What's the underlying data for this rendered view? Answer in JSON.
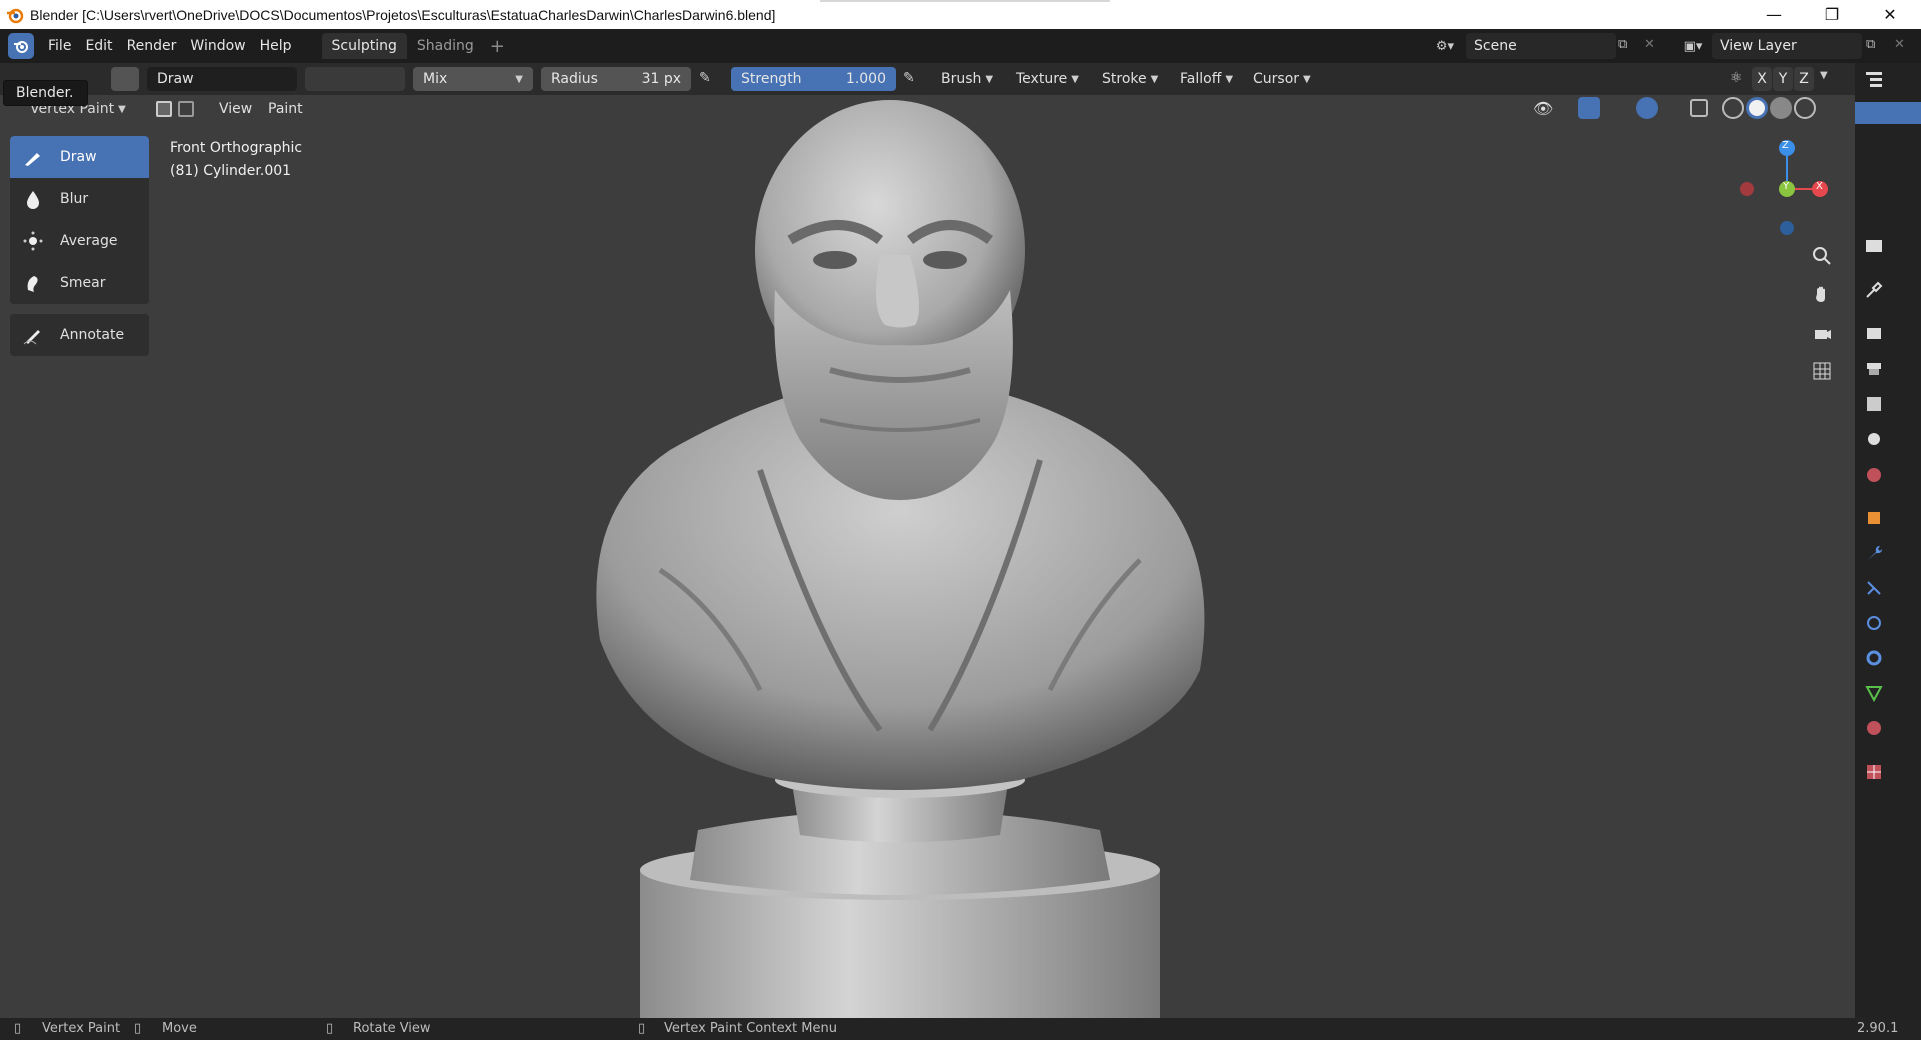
{
  "window": {
    "title": "Blender [C:\\Users\\rvert\\OneDrive\\DOCS\\Documentos\\Projetos\\Esculturas\\EstatuaCharlesDarwin\\CharlesDarwin6.blend]",
    "controls": [
      "—",
      "❐",
      "✕"
    ]
  },
  "menu": [
    "File",
    "Edit",
    "Render",
    "Window",
    "Help"
  ],
  "workspaces": [
    {
      "label": "Sculpting",
      "active": true
    },
    {
      "label": "Shading",
      "active": false
    }
  ],
  "scene": {
    "label": "Scene"
  },
  "view_layer": {
    "label": "View Layer"
  },
  "tool_header": {
    "brush_name": "Draw",
    "blend_mode": "Mix",
    "radius_label": "Radius",
    "radius_value": "31 px",
    "strength_label": "Strength",
    "strength_value": "1.000",
    "dropdowns": [
      "Brush",
      "Texture",
      "Stroke",
      "Falloff",
      "Cursor"
    ],
    "axes": [
      "X",
      "Y",
      "Z"
    ]
  },
  "header2": {
    "mode": "Vertex Paint",
    "menus": [
      "View",
      "Paint"
    ]
  },
  "tooltip": "Blender.",
  "viewport": {
    "view_name": "Front Orthographic",
    "object_name": "(81) Cylinder.001"
  },
  "tools": [
    {
      "label": "Draw",
      "icon": "brush-draw-icon",
      "active": true
    },
    {
      "label": "Blur",
      "icon": "drop-icon",
      "active": false
    },
    {
      "label": "Average",
      "icon": "average-icon",
      "active": false
    },
    {
      "label": "Smear",
      "icon": "smear-icon",
      "active": false
    },
    {
      "label": "Annotate",
      "icon": "annotate-icon",
      "active": false
    }
  ],
  "gizmo": {
    "z": "Z",
    "y": "Y",
    "x": "X"
  },
  "status": {
    "left": "Vertex Paint",
    "move": "Move",
    "rotate": "Rotate View",
    "context": "Vertex Paint Context Menu",
    "version": "2.90.1"
  },
  "colors": {
    "accent": "#4772b3",
    "x_axis": "#e5484d",
    "y_axis": "#8bc53f",
    "z_axis": "#3b8fe8"
  }
}
